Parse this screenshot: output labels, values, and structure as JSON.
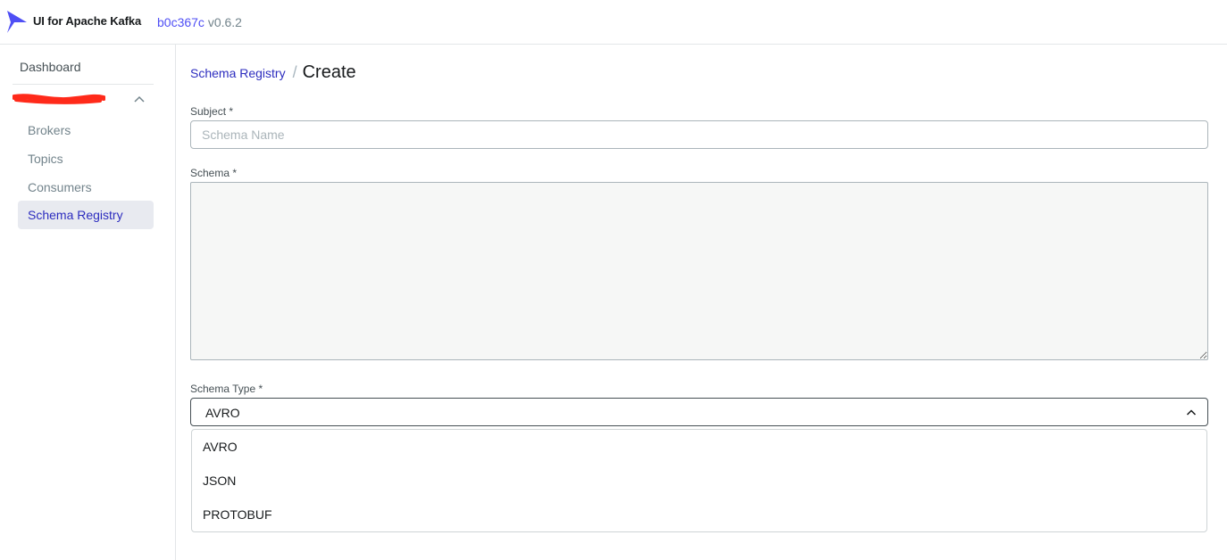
{
  "app": {
    "title": "UI for Apache Kafka",
    "commit": "b0c367c",
    "version": "v0.6.2",
    "logo_color": "#4f4ff5"
  },
  "sidebar": {
    "dashboard_label": "Dashboard",
    "cluster_name": "",
    "cluster_expanded": true,
    "items": [
      {
        "label": "Brokers",
        "active": false
      },
      {
        "label": "Topics",
        "active": false
      },
      {
        "label": "Consumers",
        "active": false
      },
      {
        "label": "Schema Registry",
        "active": true
      }
    ]
  },
  "breadcrumb": {
    "parent": "Schema Registry",
    "separator": "/",
    "current": "Create"
  },
  "form": {
    "subject_label": "Subject *",
    "subject_placeholder": "Schema Name",
    "schema_label": "Schema *",
    "schema_value": "",
    "type_label": "Schema Type *",
    "type_value": "AVRO",
    "type_options": [
      "AVRO",
      "JSON",
      "PROTOBUF"
    ]
  },
  "colors": {
    "accent": "#4f4ff5",
    "link": "#2d2dbf",
    "active_bg": "#e8eaf0",
    "redaction": "#ff2a1a"
  }
}
